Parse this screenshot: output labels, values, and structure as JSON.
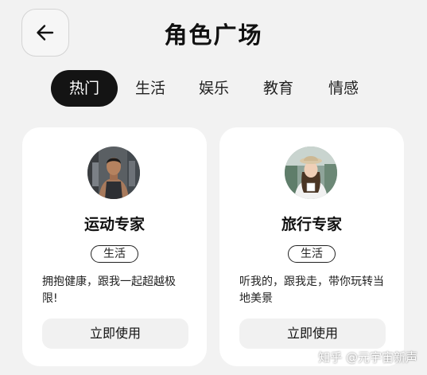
{
  "header": {
    "back_icon": "arrow-left-icon",
    "title": "角色广场"
  },
  "tabs": [
    {
      "label": "热门",
      "active": true
    },
    {
      "label": "生活",
      "active": false
    },
    {
      "label": "娱乐",
      "active": false
    },
    {
      "label": "教育",
      "active": false
    },
    {
      "label": "情感",
      "active": false
    }
  ],
  "cards": [
    {
      "name": "运动专家",
      "tag": "生活",
      "description": "拥抱健康，跟我一起超越极限!",
      "button_label": "立即使用"
    },
    {
      "name": "旅行专家",
      "tag": "生活",
      "description": "听我的，跟我走，带你玩转当地美景",
      "button_label": "立即使用"
    }
  ],
  "watermark": "知乎 @元宇宙新声",
  "colors": {
    "active_tab_bg": "#141414",
    "page_bg": "#f2f2f2",
    "card_bg": "#ffffff",
    "button_bg": "#f1f1f1"
  }
}
